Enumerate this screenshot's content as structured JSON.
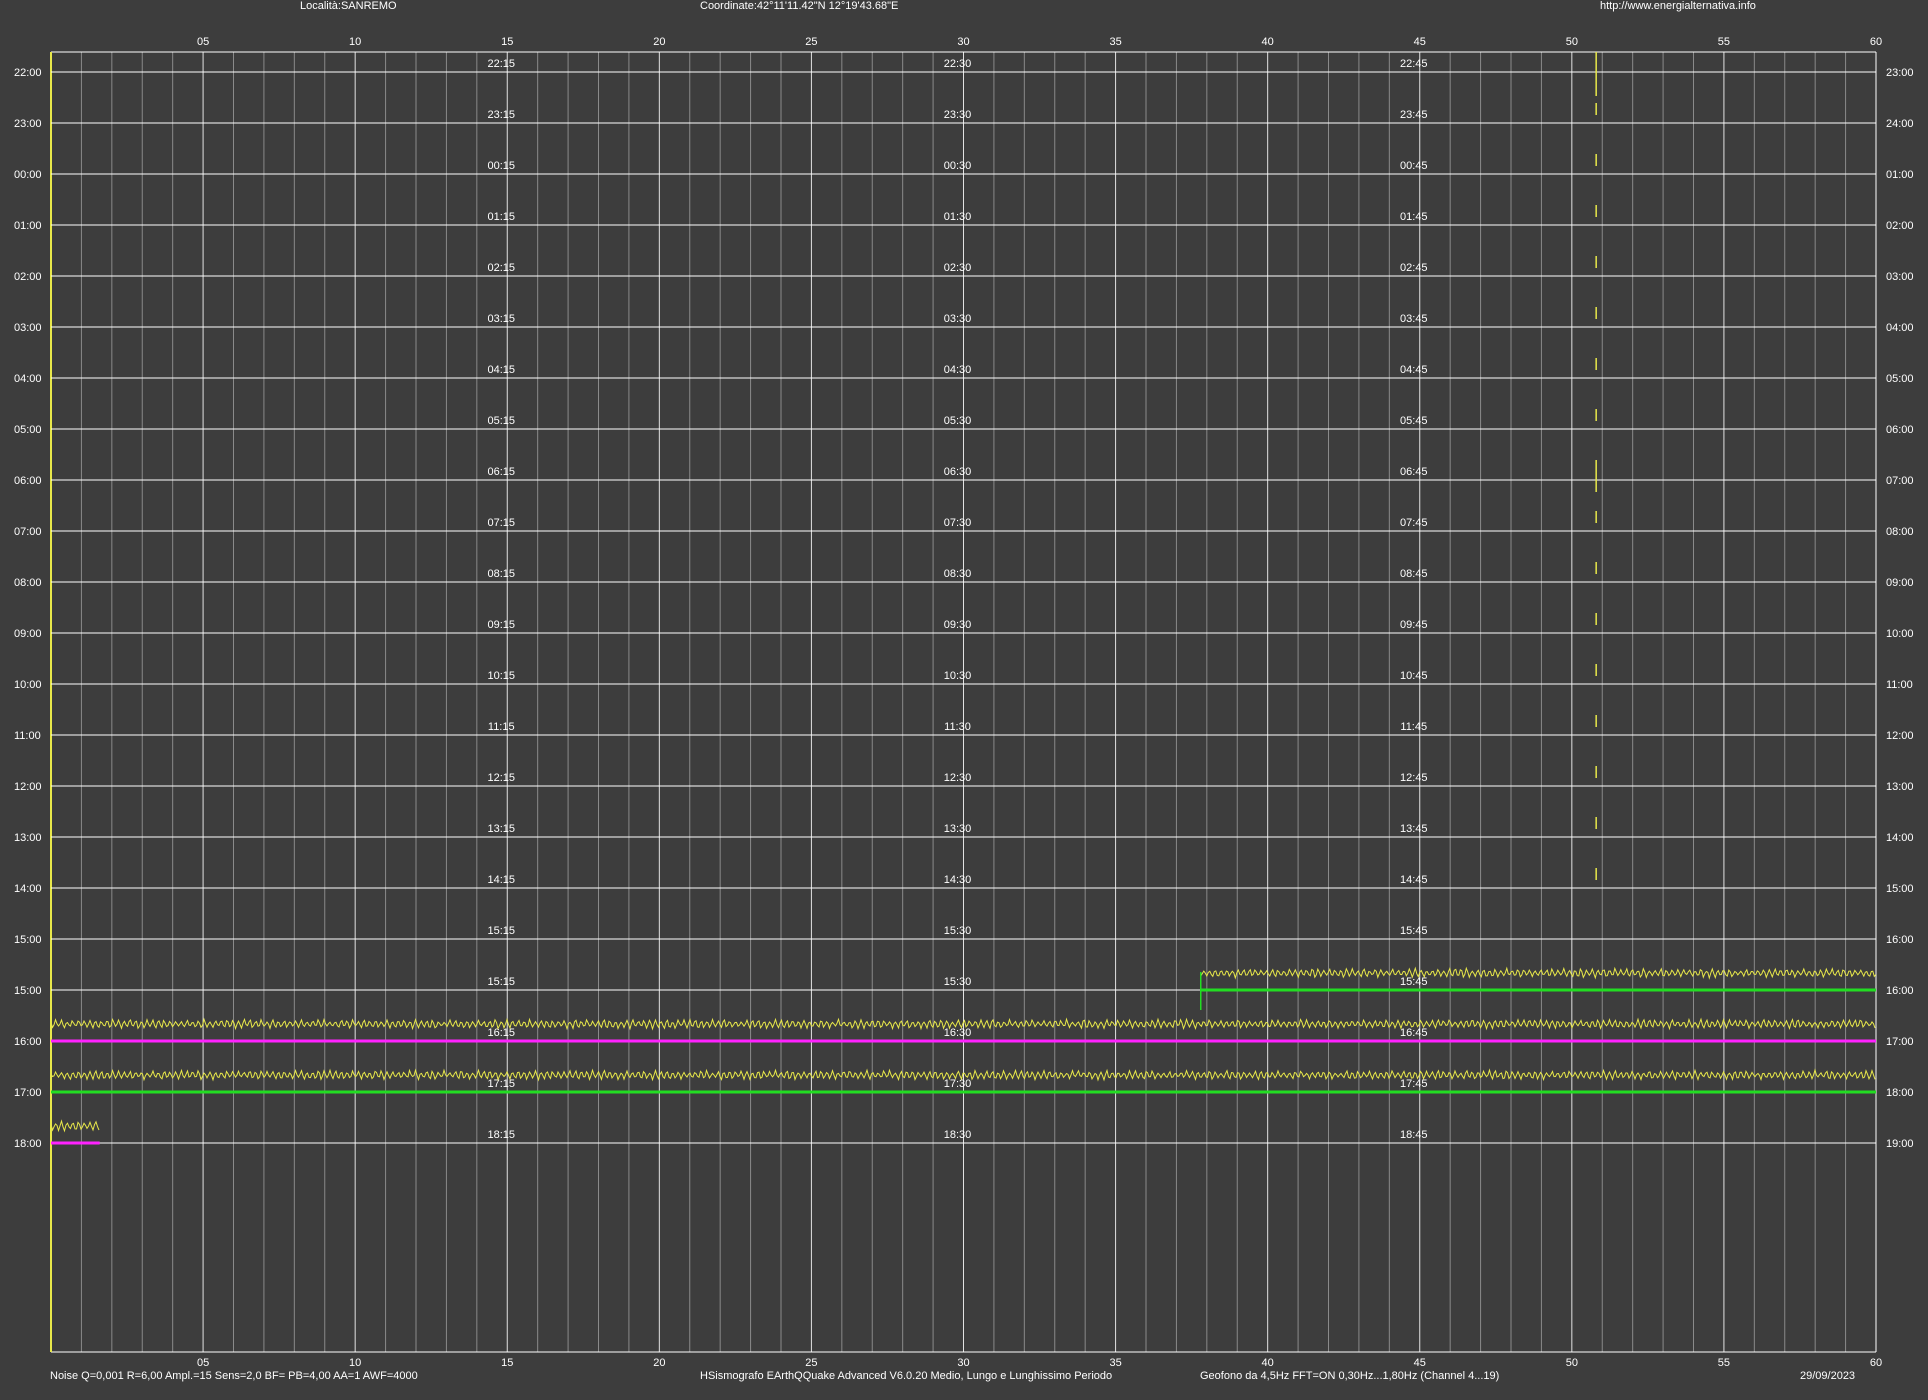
{
  "header": {
    "location": "Località:SANREMO",
    "coordinates": "Coordinate:42°11'11.42\"N  12°19'43.68\"E",
    "url": "http://www.energialternativa.info"
  },
  "footer": {
    "params": "Noise Q=0,001 R=6,00 Ampl.=15 Sens=2,0 BF= PB=4,00 AA=1 AWF=4000",
    "software": "HSismografo  EArthQQuake Advanced V6.0.20  Medio, Lungo e Lunghissimo Periodo",
    "sensor": "Geofono da 4,5Hz FFT=ON 0,30Hz...1,80Hz      (Channel 4...19)",
    "date": "29/09/2023"
  },
  "colors": {
    "background": "#3d3d3d",
    "grid_major": "#ffffff",
    "grid_minor": "#8a8a8a",
    "trace": "#e8e84a",
    "green_line": "#22dd22",
    "magenta_line": "#ff22ff"
  },
  "chart_data": {
    "type": "line",
    "title": "",
    "x_ticks": [
      "05",
      "10",
      "15",
      "20",
      "25",
      "30",
      "35",
      "40",
      "45",
      "50",
      "55",
      "60"
    ],
    "xlim": [
      0,
      60
    ],
    "left_hour_labels": [
      "22:00",
      "23:00",
      "00:00",
      "01:00",
      "02:00",
      "03:00",
      "04:00",
      "05:00",
      "06:00",
      "07:00",
      "08:00",
      "09:00",
      "10:00",
      "11:00",
      "12:00",
      "13:00",
      "14:00",
      "15:00",
      "15:00",
      "16:00",
      "17:00",
      "18:00"
    ],
    "right_hour_labels": [
      "23:00",
      "24:00",
      "01:00",
      "02:00",
      "03:00",
      "04:00",
      "05:00",
      "06:00",
      "07:00",
      "08:00",
      "09:00",
      "10:00",
      "11:00",
      "12:00",
      "13:00",
      "14:00",
      "15:00",
      "16:00",
      "16:00",
      "17:00",
      "18:00",
      "19:00"
    ],
    "quarter_labels": [
      [
        "22:15",
        "22:30",
        "22:45"
      ],
      [
        "23:15",
        "23:30",
        "23:45"
      ],
      [
        "00:15",
        "00:30",
        "00:45"
      ],
      [
        "01:15",
        "01:30",
        "01:45"
      ],
      [
        "02:15",
        "02:30",
        "02:45"
      ],
      [
        "03:15",
        "03:30",
        "03:45"
      ],
      [
        "04:15",
        "04:30",
        "04:45"
      ],
      [
        "05:15",
        "05:30",
        "05:45"
      ],
      [
        "06:15",
        "06:30",
        "06:45"
      ],
      [
        "07:15",
        "07:30",
        "07:45"
      ],
      [
        "08:15",
        "08:30",
        "08:45"
      ],
      [
        "09:15",
        "09:30",
        "09:45"
      ],
      [
        "10:15",
        "10:30",
        "10:45"
      ],
      [
        "11:15",
        "11:30",
        "11:45"
      ],
      [
        "12:15",
        "12:30",
        "12:45"
      ],
      [
        "13:15",
        "13:30",
        "13:45"
      ],
      [
        "14:15",
        "14:30",
        "14:45"
      ],
      [
        "15:15",
        "15:30",
        "15:45"
      ],
      [
        "15:15",
        "15:30",
        "15:45"
      ],
      [
        "16:15",
        "16:30",
        "16:45"
      ],
      [
        "17:15",
        "17:30",
        "17:45"
      ],
      [
        "18:15",
        "18:30",
        "18:45"
      ]
    ],
    "hourly_spike_minute": 50.8,
    "spike_rows": [
      0,
      1,
      2,
      3,
      4,
      5,
      6,
      7,
      8,
      9,
      10,
      11,
      12,
      13,
      14,
      15,
      16
    ],
    "trace_segments": [
      {
        "row": 18,
        "start_minute": 37.8,
        "end_minute": 60,
        "baseline": "green"
      },
      {
        "row": 19,
        "start_minute": 0,
        "end_minute": 60,
        "baseline": "magenta"
      },
      {
        "row": 20,
        "start_minute": 0,
        "end_minute": 60,
        "baseline": "green"
      },
      {
        "row": 21,
        "start_minute": 0,
        "end_minute": 1.6,
        "baseline": "magenta"
      }
    ],
    "grid": true
  }
}
